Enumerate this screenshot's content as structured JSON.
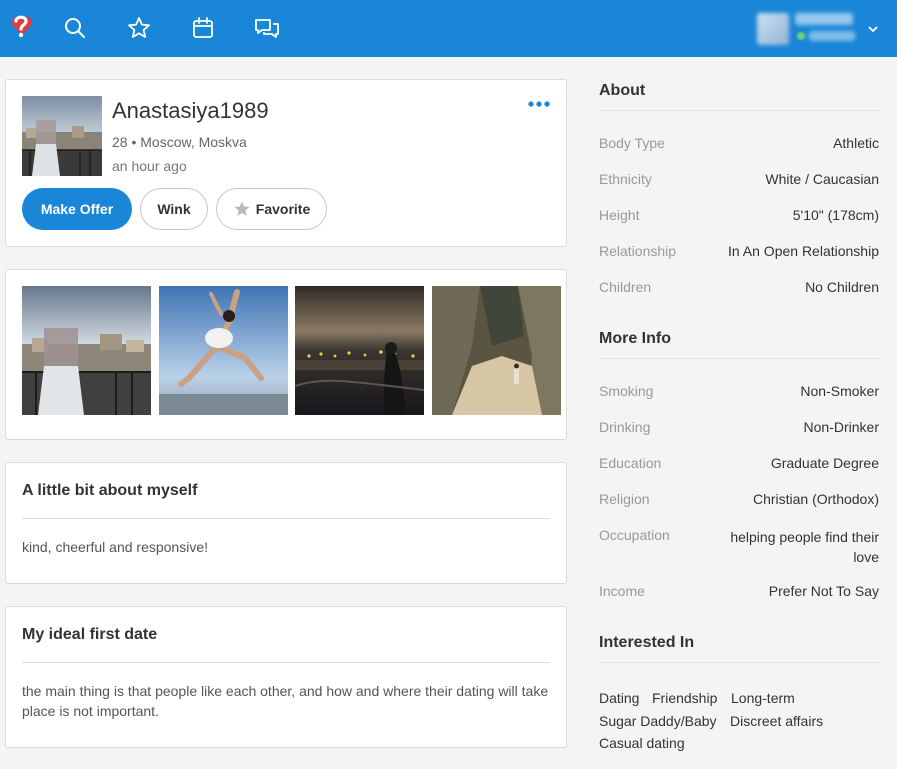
{
  "icons": {
    "logo": "heart-question-logo",
    "search": "search-icon",
    "favorites": "star-icon",
    "calendar": "calendar-icon",
    "messages": "chat-bubbles-icon",
    "account_menu": "chevron-down-icon"
  },
  "colors": {
    "brand": "#1a86d8",
    "logo_heart": "#e23b3b"
  },
  "profile": {
    "username": "Anastasiya1989",
    "age_location": "28 • Moscow, Moskva",
    "last_active": "an hour ago",
    "buttons": {
      "offer": "Make Offer",
      "wink": "Wink",
      "favorite": "Favorite"
    }
  },
  "about_myself": {
    "title": "A little bit about myself",
    "text": "kind, cheerful and responsive!"
  },
  "ideal_date": {
    "title": "My ideal first date",
    "text": "the main thing is that people like each other, and how and where their dating will take place is not important."
  },
  "about": {
    "title": "About",
    "rows": [
      {
        "label": "Body Type",
        "value": "Athletic"
      },
      {
        "label": "Ethnicity",
        "value": "White / Caucasian"
      },
      {
        "label": "Height",
        "value": "5'10\" (178cm)"
      },
      {
        "label": "Relationship",
        "value": "In An Open Relationship"
      },
      {
        "label": "Children",
        "value": "No Children"
      }
    ]
  },
  "more_info": {
    "title": "More Info",
    "rows": [
      {
        "label": "Smoking",
        "value": "Non-Smoker"
      },
      {
        "label": "Drinking",
        "value": "Non-Drinker"
      },
      {
        "label": "Education",
        "value": "Graduate Degree"
      },
      {
        "label": "Religion",
        "value": "Christian (Orthodox)"
      },
      {
        "label": "Occupation",
        "value": "helping people find their love"
      },
      {
        "label": "Income",
        "value": "Prefer Not To Say"
      }
    ]
  },
  "interested_in": {
    "title": "Interested In",
    "tags": [
      "Dating",
      "Friendship",
      "Long-term",
      "Sugar Daddy/Baby",
      "Discreet affairs",
      "Casual dating"
    ]
  }
}
